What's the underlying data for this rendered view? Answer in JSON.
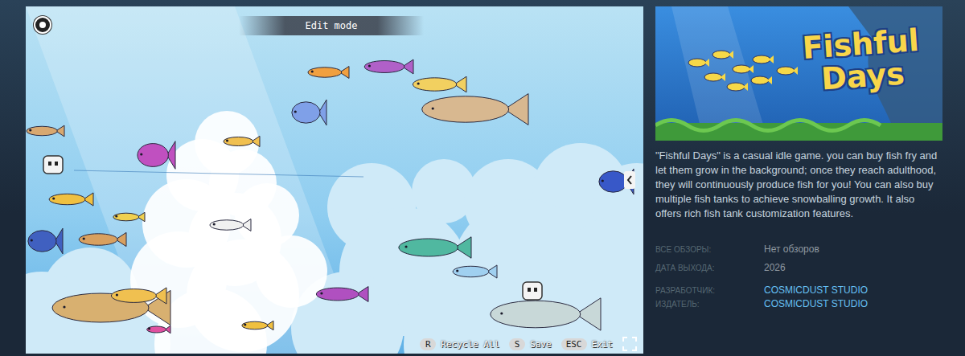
{
  "screenshot": {
    "mode_label": "Edit mode",
    "hints": [
      {
        "key": "R",
        "label": "Recycle All"
      },
      {
        "key": "S",
        "label": "Save"
      },
      {
        "key": "ESC",
        "label": "Exit"
      }
    ]
  },
  "capsule": {
    "logo_lines": [
      "Fishful",
      "Days"
    ]
  },
  "description": "\"Fishful Days\" is a casual idle game. you can buy fish fry and let them grow in the background; once they reach adulthood, they will continuously produce fish for you! You can also buy multiple fish tanks to achieve snowballing growth. It also offers rich fish tank customization features.",
  "summary": [
    {
      "label": "ВСЕ ОБЗОРЫ:",
      "value": "Нет обзоров",
      "kind": "text"
    },
    {
      "label": "ДАТА ВЫХОДА:",
      "value": "2026",
      "kind": "text"
    }
  ],
  "credits": [
    {
      "label": "РАЗРАБОТЧИК:",
      "value": "COSMICDUST STUDIO",
      "kind": "link"
    },
    {
      "label": "ИЗДАТЕЛЬ:",
      "value": "COSMICDUST STUDIO",
      "kind": "link"
    }
  ]
}
